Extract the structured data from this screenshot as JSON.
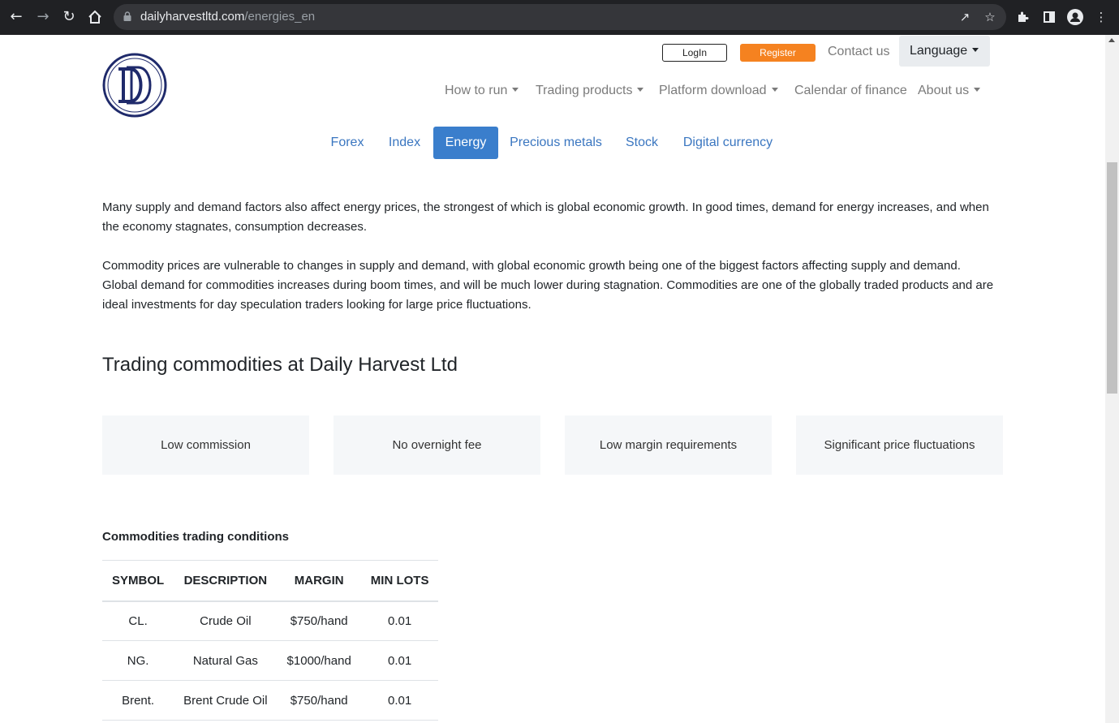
{
  "browser": {
    "url_domain": "dailyharvestltd.com",
    "url_path": "/energies_en"
  },
  "header": {
    "login_label": "LogIn",
    "register_label": "Register",
    "contact_label": "Contact us",
    "language_label": "Language"
  },
  "mainnav": [
    {
      "label": "How to run"
    },
    {
      "label": "Trading products"
    },
    {
      "label": "Platform download"
    },
    {
      "label": "Calendar of finance"
    },
    {
      "label": "About us"
    }
  ],
  "subnav": [
    {
      "label": "Forex",
      "active": false
    },
    {
      "label": "Index",
      "active": false
    },
    {
      "label": "Energy",
      "active": true
    },
    {
      "label": "Precious metals",
      "active": false
    },
    {
      "label": "Stock",
      "active": false
    },
    {
      "label": "Digital currency",
      "active": false
    }
  ],
  "content": {
    "paragraph1": "Many supply and demand factors also affect energy prices, the strongest of which is global economic growth. In good times, demand for energy increases, and when the economy stagnates, consumption decreases.",
    "paragraph2": "Commodity prices are vulnerable to changes in supply and demand, with global economic growth being one of the biggest factors affecting supply and demand. Global demand for commodities increases during boom times, and will be much lower during stagnation. Commodities are one of the globally traded products and are ideal investments for day speculation traders looking for large price fluctuations.",
    "section_title": "Trading commodities at Daily Harvest Ltd",
    "features": [
      "Low commission",
      "No overnight fee",
      "Low margin requirements",
      "Significant price fluctuations"
    ],
    "table_title": "Commodities trading conditions"
  },
  "table": {
    "headers": [
      "SYMBOL",
      "DESCRIPTION",
      "MARGIN",
      "MIN LOTS"
    ],
    "rows": [
      [
        "CL.",
        "Crude Oil",
        "$750/hand",
        "0.01"
      ],
      [
        "NG.",
        "Natural Gas",
        "$1000/hand",
        "0.01"
      ],
      [
        "Brent.",
        "Brent Crude Oil",
        "$750/hand",
        "0.01"
      ]
    ]
  },
  "colors": {
    "accent": "#3a7ecc",
    "register": "#f58220",
    "logo": "#1f2a6b"
  }
}
